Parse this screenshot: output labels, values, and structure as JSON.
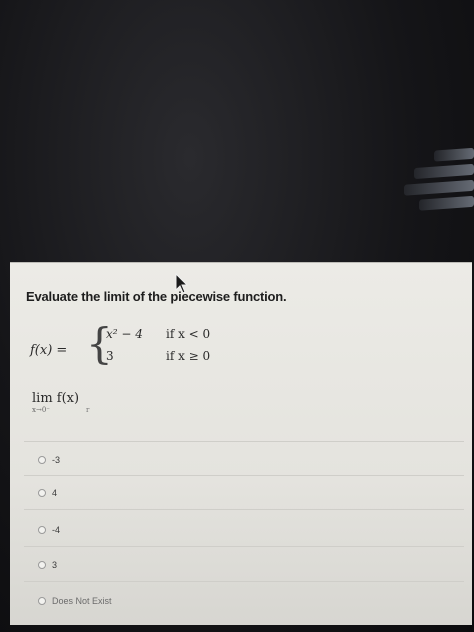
{
  "question": {
    "title": "Evaluate the limit of the piecewise function."
  },
  "function": {
    "lhs": "f(x) =",
    "brace": "{",
    "cases": [
      {
        "expr": "x² − 4",
        "cond": "if x < 0"
      },
      {
        "expr": "3",
        "cond": "if x ≥ 0"
      }
    ]
  },
  "limit": {
    "expression": "lim  f(x)",
    "subscript": "x→0⁻",
    "subscript_extra": "r"
  },
  "options": [
    {
      "label": "-3"
    },
    {
      "label": "4"
    },
    {
      "label": "-4"
    },
    {
      "label": "3"
    },
    {
      "label": "Does Not Exist"
    }
  ]
}
